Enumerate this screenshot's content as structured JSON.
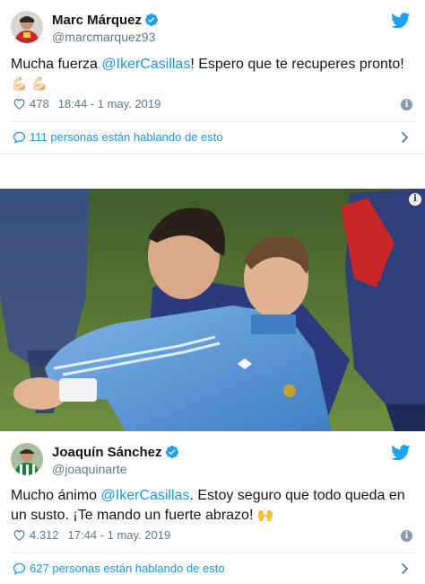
{
  "tweets": [
    {
      "name": "Marc Márquez",
      "handle": "@marcmarquez93",
      "text_pre": "Mucha fuerza ",
      "mention": "@IkerCasillas",
      "text_post": "! Espero que te recuperes pronto! ",
      "emoji": "💪🏻 💪🏻",
      "likes": "478",
      "time": "18:44 - 1 may. 2019",
      "conversation": "111 personas están hablando de esto"
    },
    {
      "name": "Joaquín Sánchez",
      "handle": "@joaquinarte",
      "text_pre": "Mucho ánimo ",
      "mention": "@IkerCasillas",
      "text_post": ".  Estoy seguro que todo queda en un susto. ¡Te mando un fuerte abrazo! ",
      "emoji": "🙌",
      "likes": "4.312",
      "time": "17:44 - 1 may. 2019",
      "conversation": "627 personas están hablando de esto"
    }
  ],
  "colors": {
    "link": "#1b95e0",
    "verified": "#1da1f2",
    "muted": "#657786",
    "divider": "#e6ecf0"
  },
  "icons": {
    "verified": "verified-badge-icon",
    "brand": "twitter-bird-icon",
    "like": "heart-icon",
    "info": "info-icon",
    "conversation": "speech-bubble-icon",
    "chevron": "chevron-right-icon"
  }
}
